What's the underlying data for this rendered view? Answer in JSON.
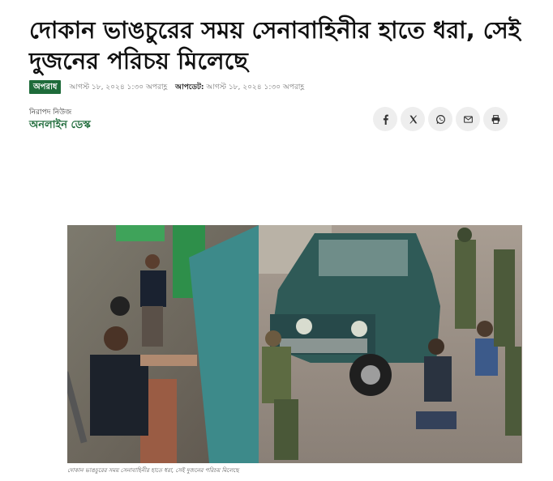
{
  "article": {
    "headline": "দোকান ভাঙচুরের সময় সেনাবাহিনীর হাতে ধরা, সেই দুজনের পরিচয় মিলেছে",
    "category": "অপরাধ",
    "published": "আগস্ট ১৮, ২০২৪ ১:৩০ অপরাহ্ণ",
    "updated_label": "আপডেট:",
    "updated": "আগস্ট ১৮, ২০২৪ ১:৩০ অপরাহ্ণ",
    "source": "নিরাপদ নিউজ",
    "author": "অনলাইন ডেস্ক",
    "image_caption": "দোকান ভাঙচুরের সময় সেনাবাহিনীর হাতে ধরা, সেই দুজনের পরিচয় মিলেছে"
  },
  "share": {
    "icons": [
      "facebook-icon",
      "x-icon",
      "whatsapp-icon",
      "email-icon",
      "print-icon"
    ]
  },
  "colors": {
    "accent": "#1e6b3a",
    "share_bg": "#eeeeee"
  }
}
